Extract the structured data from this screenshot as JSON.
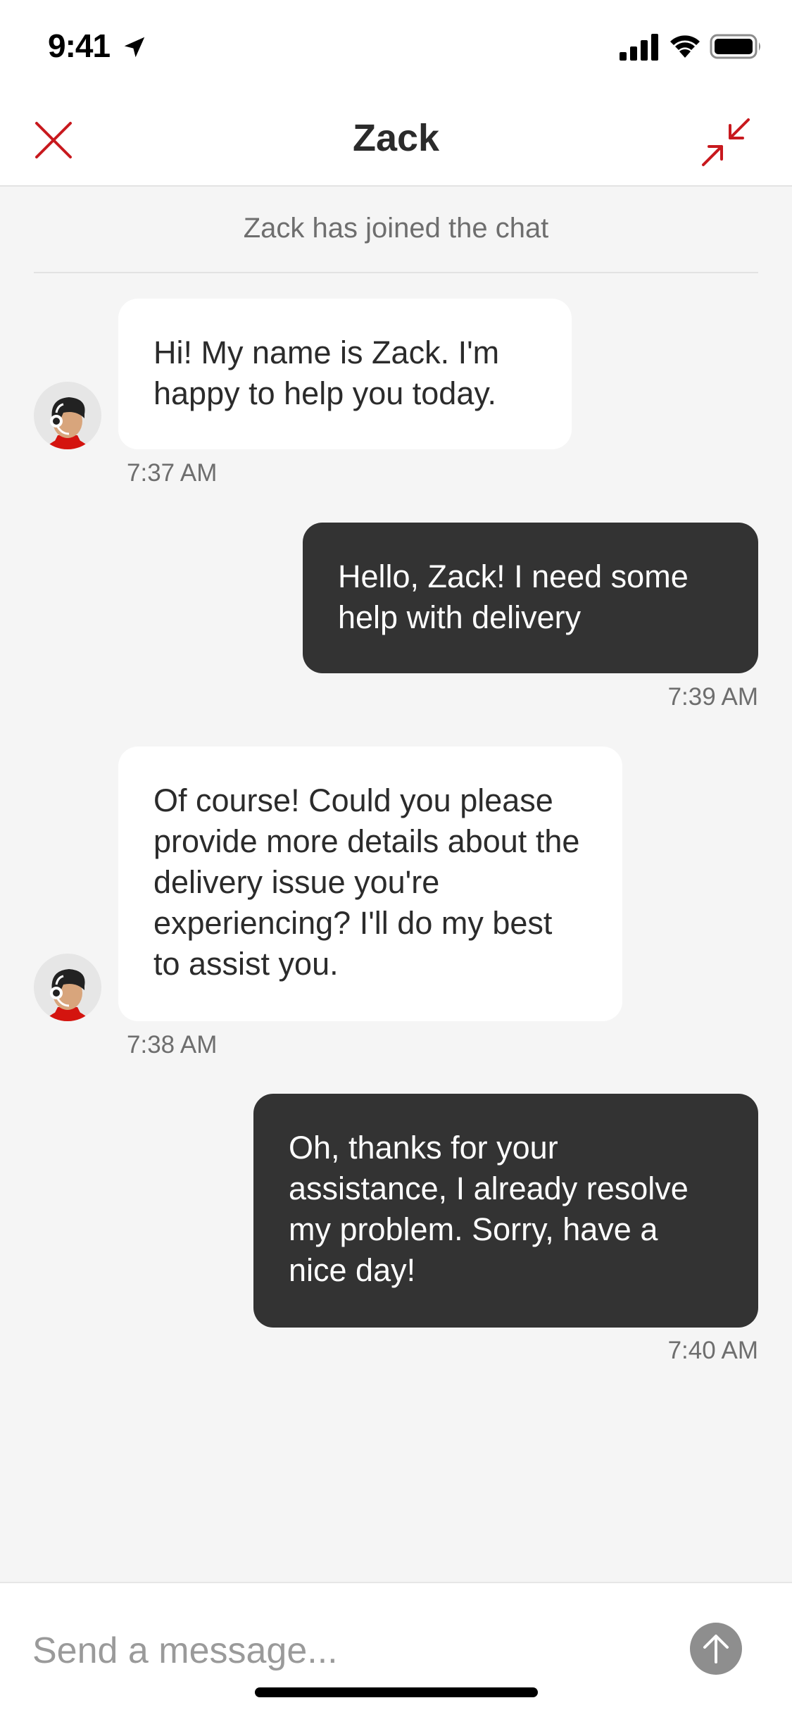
{
  "status_bar": {
    "time": "9:41"
  },
  "header": {
    "title": "Zack"
  },
  "chat": {
    "system_message": "Zack has joined the chat",
    "messages": [
      {
        "sender": "agent",
        "text": "Hi! My name is Zack. I'm happy to help you today.",
        "time": "7:37 AM"
      },
      {
        "sender": "user",
        "text": "Hello, Zack! I need some help with delivery",
        "time": "7:39 AM"
      },
      {
        "sender": "agent",
        "text": "Of course! Could you please provide more details about the delivery issue you're experiencing? I'll do my best to assist you.",
        "time": "7:38 AM"
      },
      {
        "sender": "user",
        "text": "Oh, thanks for your assistance, I already resolve my problem. Sorry, have a nice day!",
        "time": "7:40 AM"
      }
    ]
  },
  "composer": {
    "placeholder": "Send a message..."
  },
  "colors": {
    "accent": "#c8191e",
    "user_bubble": "#333333",
    "agent_bubble": "#ffffff",
    "background": "#f5f5f5"
  },
  "icons": [
    "location-arrow-icon",
    "signal-icon",
    "wifi-icon",
    "battery-icon",
    "close-icon",
    "minimize-icon",
    "agent-avatar",
    "send-arrow-icon"
  ]
}
